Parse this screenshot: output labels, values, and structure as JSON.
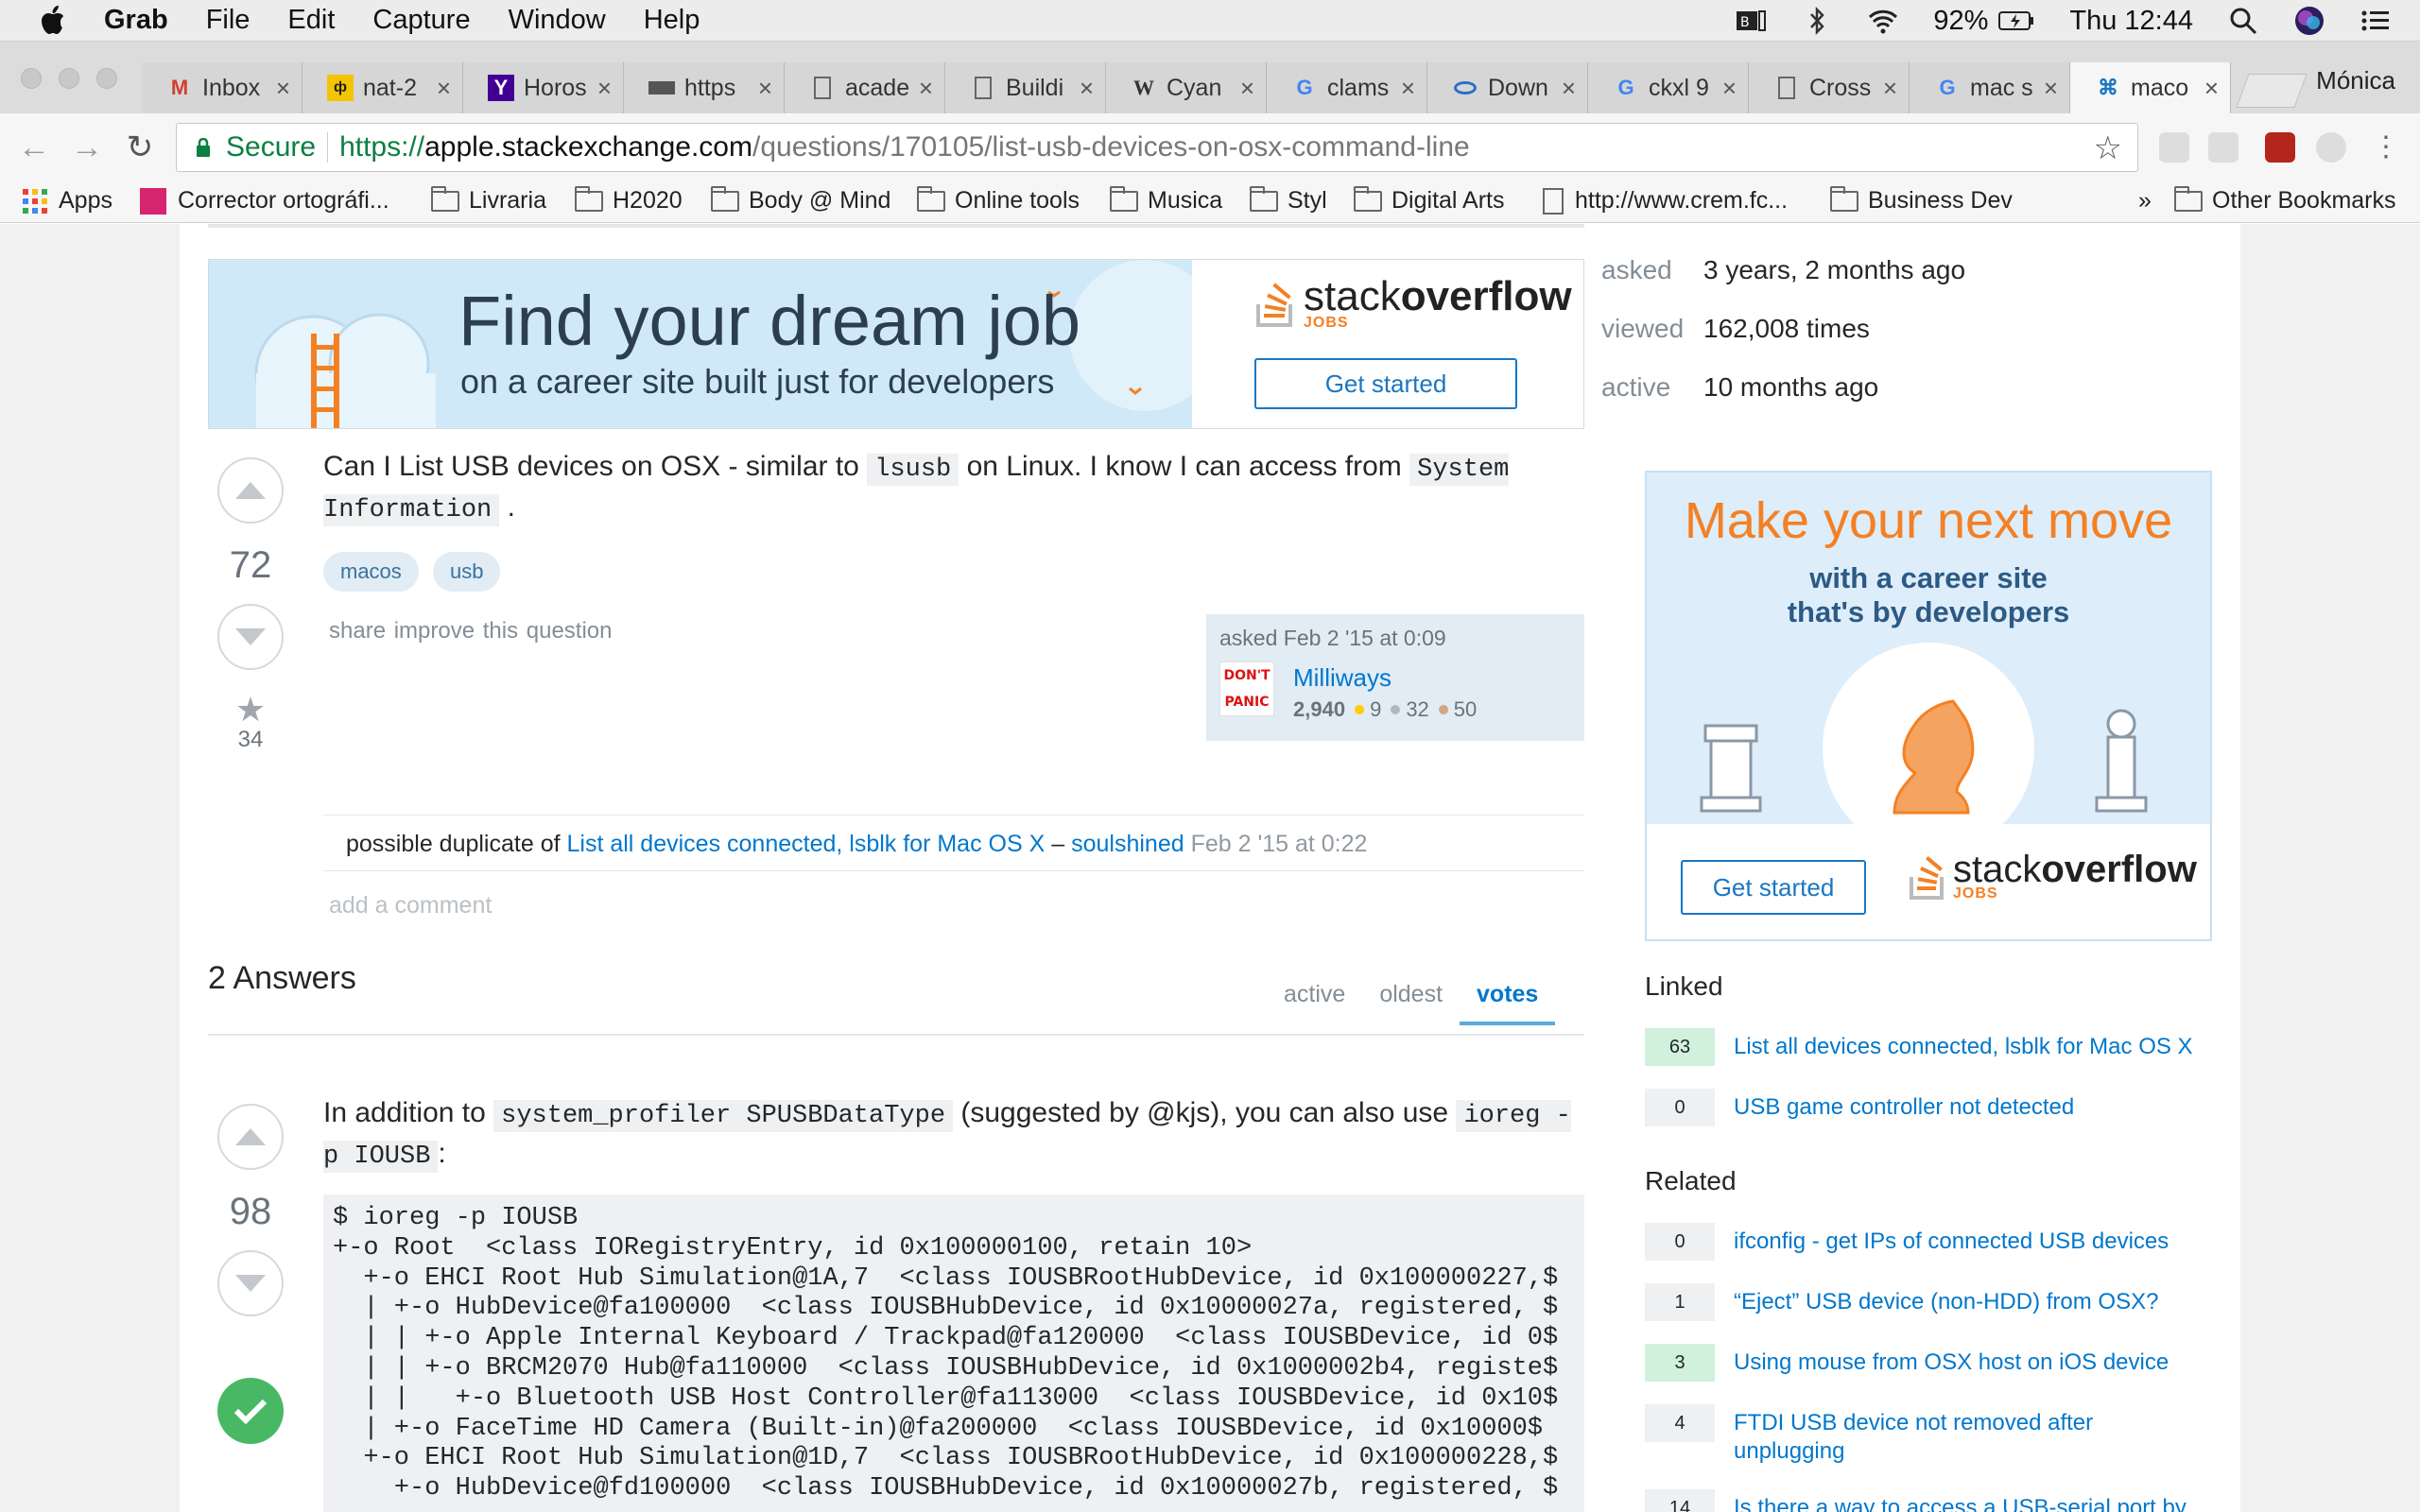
{
  "menubar": {
    "app": "Grab",
    "items": [
      "File",
      "Edit",
      "Capture",
      "Window",
      "Help"
    ],
    "battery": "92%",
    "clock": "Thu 12:44"
  },
  "tabs": [
    {
      "label": "Inbox",
      "icon": "gmail-icon"
    },
    {
      "label": "nat-2",
      "icon": "nat-icon"
    },
    {
      "label": "Horos",
      "icon": "yahoo-icon"
    },
    {
      "label": "https",
      "icon": "site-icon"
    },
    {
      "label": "acade",
      "icon": "page-icon"
    },
    {
      "label": "Buildi",
      "icon": "page-icon"
    },
    {
      "label": "Cyan",
      "icon": "wikipedia-icon"
    },
    {
      "label": "clams",
      "icon": "google-icon"
    },
    {
      "label": "Down",
      "icon": "eye-icon"
    },
    {
      "label": "ckxl 9",
      "icon": "google-icon"
    },
    {
      "label": "Cross",
      "icon": "page-icon"
    },
    {
      "label": "mac s",
      "icon": "google-icon"
    },
    {
      "label": "maco",
      "icon": "command-icon",
      "active": true
    }
  ],
  "profile": "Mónica",
  "address": {
    "secure": "Secure",
    "scheme": "https://",
    "host": "apple.stackexchange.com",
    "path": "/questions/170105/list-usb-devices-on-osx-command-line"
  },
  "bookmarks": [
    {
      "label": "Apps",
      "icon": "apps-grid-icon"
    },
    {
      "label": "Corrector ortográfi...",
      "icon": "site-icon"
    },
    {
      "label": "Livraria",
      "icon": "folder-icon"
    },
    {
      "label": "H2020",
      "icon": "folder-icon"
    },
    {
      "label": "Body @ Mind",
      "icon": "folder-icon"
    },
    {
      "label": "Online tools",
      "icon": "folder-icon"
    },
    {
      "label": "Musica",
      "icon": "folder-icon"
    },
    {
      "label": "Styl",
      "icon": "folder-icon"
    },
    {
      "label": "Digital Arts",
      "icon": "folder-icon"
    },
    {
      "label": "http://www.crem.fc...",
      "icon": "page-icon"
    },
    {
      "label": "Business Dev",
      "icon": "folder-icon"
    }
  ],
  "bookmarks_overflow": "»",
  "other_bookmarks": "Other Bookmarks",
  "banner": {
    "headline": "Find your dream job",
    "subline": "on a career site built just for developers",
    "logo_light": "stack",
    "logo_bold": "overflow",
    "logo_jobs": "JOBS",
    "cta": "Get started"
  },
  "stats": [
    {
      "key": "asked",
      "value": "3 years, 2 months ago"
    },
    {
      "key": "viewed",
      "value": "162,008 times"
    },
    {
      "key": "active",
      "value": "10 months ago"
    }
  ],
  "question": {
    "votes": "72",
    "favorites": "34",
    "text_1": "Can I List USB devices on OSX - similar to",
    "code_1": "lsusb",
    "text_2": "on Linux. I know I can access from",
    "code_2": "System Information",
    "text_3": ".",
    "tags": [
      "macos",
      "usb"
    ],
    "share": "share",
    "improve": "improve this question",
    "asked": "asked Feb 2 '15 at 0:09",
    "owner": "Milliways",
    "avatar_line1": "DON'T",
    "avatar_line2": "PANIC",
    "rep": "2,940",
    "gold": "9",
    "silver": "32",
    "bronze": "50",
    "comment": {
      "prefix": "possible duplicate of",
      "link": "List all devices connected, lsblk for Mac OS X",
      "dash": "–",
      "user": "soulshined",
      "date": "Feb 2 '15 at 0:22"
    },
    "add_comment": "add a comment"
  },
  "answers": {
    "header": "2 Answers",
    "sort": [
      "active",
      "oldest",
      "votes"
    ],
    "sort_active": "votes",
    "first": {
      "votes": "98",
      "text_1": "In addition to",
      "code_1": "system_profiler SPUSBDataType",
      "text_2": "(suggested by @kjs), you can also use",
      "code_2": "ioreg -p IOUSB",
      "text_3": ":",
      "code_block": "$ ioreg -p IOUSB\n+-o Root  <class IORegistryEntry, id 0x100000100, retain 10>\n  +-o EHCI Root Hub Simulation@1A,7  <class IOUSBRootHubDevice, id 0x100000227,$\n  | +-o HubDevice@fa100000  <class IOUSBHubDevice, id 0x10000027a, registered, $\n  | | +-o Apple Internal Keyboard / Trackpad@fa120000  <class IOUSBDevice, id 0$\n  | | +-o BRCM2070 Hub@fa110000  <class IOUSBHubDevice, id 0x1000002b4, registe$\n  | |   +-o Bluetooth USB Host Controller@fa113000  <class IOUSBDevice, id 0x10$\n  | +-o FaceTime HD Camera (Built-in)@fa200000  <class IOUSBDevice, id 0x10000$\n  +-o EHCI Root Hub Simulation@1D,7  <class IOUSBRootHubDevice, id 0x100000228,$\n    +-o HubDevice@fd100000  <class IOUSBHubDevice, id 0x10000027b, registered, $"
    }
  },
  "sidead": {
    "headline": "Make your next move",
    "sub_1": "with a career site",
    "sub_2": "that's by developers",
    "cta": "Get started",
    "logo_light": "stack",
    "logo_bold": "overflow",
    "logo_jobs": "JOBS"
  },
  "linked": {
    "title": "Linked",
    "items": [
      {
        "count": "63",
        "title": "List all devices connected, lsblk for Mac OS X",
        "answered": true
      },
      {
        "count": "0",
        "title": "USB game controller not detected",
        "answered": false
      }
    ]
  },
  "related": {
    "title": "Related",
    "items": [
      {
        "count": "0",
        "title": "ifconfig - get IPs of connected USB devices",
        "answered": false
      },
      {
        "count": "1",
        "title": "“Eject” USB device (non-HDD) from OSX?",
        "answered": false
      },
      {
        "count": "3",
        "title": "Using mouse from OSX host on iOS device",
        "answered": true
      },
      {
        "count": "4",
        "title": "FTDI USB device not removed after unplugging",
        "answered": false
      },
      {
        "count": "14",
        "title": "Is there a way to access a USB-serial port by",
        "answered": false
      }
    ]
  },
  "colors": {
    "link": "#0077cc",
    "accepted": "#48b865",
    "orange": "#f48024"
  }
}
